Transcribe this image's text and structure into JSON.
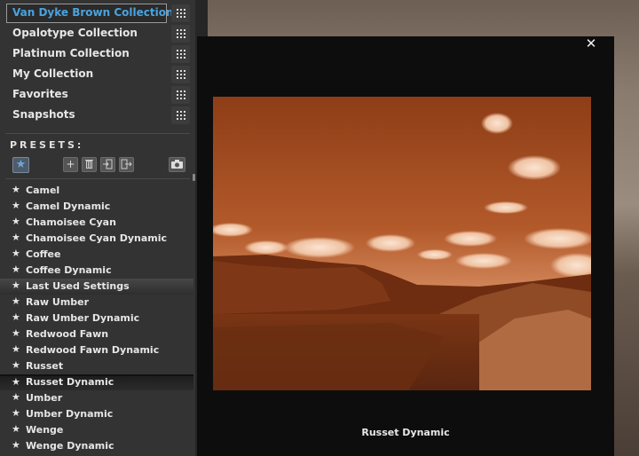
{
  "collections": [
    {
      "label": "Van Dyke Brown Collection",
      "selected": true
    },
    {
      "label": "Opalotype Collection",
      "selected": false
    },
    {
      "label": "Platinum Collection",
      "selected": false
    },
    {
      "label": "My Collection",
      "selected": false
    },
    {
      "label": "Favorites",
      "selected": false
    },
    {
      "label": "Snapshots",
      "selected": false
    }
  ],
  "presets": {
    "heading": "PRESETS:",
    "toolbar": {
      "favorite_icon": "star-icon",
      "add_icon": "plus-icon",
      "delete_icon": "trash-icon",
      "import_icon": "import-icon",
      "export_icon": "export-icon",
      "snapshot_icon": "camera-icon"
    },
    "items": [
      {
        "label": "Camel"
      },
      {
        "label": "Camel Dynamic"
      },
      {
        "label": "Chamoisee Cyan"
      },
      {
        "label": "Chamoisee Cyan Dynamic"
      },
      {
        "label": "Coffee"
      },
      {
        "label": "Coffee Dynamic"
      },
      {
        "label": "Last Used Settings",
        "state": "hover"
      },
      {
        "label": "Raw Umber"
      },
      {
        "label": "Raw Umber Dynamic"
      },
      {
        "label": "Redwood Fawn"
      },
      {
        "label": "Redwood Fawn Dynamic"
      },
      {
        "label": "Russet"
      },
      {
        "label": "Russet Dynamic",
        "state": "selected"
      },
      {
        "label": "Umber"
      },
      {
        "label": "Umber Dynamic"
      },
      {
        "label": "Wenge"
      },
      {
        "label": "Wenge Dynamic"
      }
    ]
  },
  "preview": {
    "caption": "Russet Dynamic",
    "close_icon": "close-icon",
    "tone_color": "#b5582c"
  },
  "colors": {
    "accent": "#4aa3df",
    "panel": "#333333"
  }
}
